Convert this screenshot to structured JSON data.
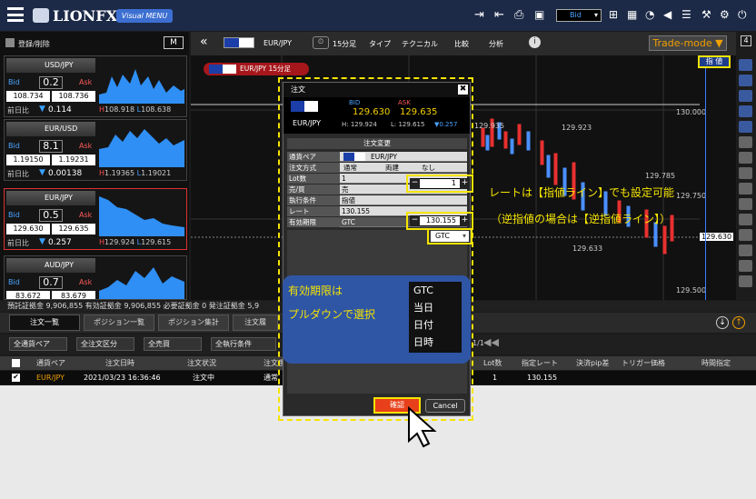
{
  "app": {
    "logo_text": "LIONFX",
    "visual_menu": "Visual MENU",
    "price_type_select": "Bid",
    "accent": "#f5e400"
  },
  "pairs": [
    {
      "name": "USD/JPY",
      "bid_label": "Bid",
      "ask_label": "Ask",
      "spread": "0.2",
      "bid": "108.734",
      "ask": "108.736",
      "prev_label": "前日比",
      "change": "0.114",
      "high": "108.918",
      "low": "108.638"
    },
    {
      "name": "EUR/USD",
      "bid_label": "Bid",
      "ask_label": "Ask",
      "spread": "8.1",
      "bid": "1.19150",
      "ask": "1.19231",
      "prev_label": "前日比",
      "change": "0.00138",
      "high": "1.19365",
      "low": "1.19021"
    },
    {
      "name": "EUR/JPY",
      "bid_label": "Bid",
      "ask_label": "Ask",
      "spread": "0.5",
      "bid": "129.630",
      "ask": "129.635",
      "prev_label": "前日比",
      "change": "0.257",
      "high": "129.924",
      "low": "129.615"
    },
    {
      "name": "AUD/JPY",
      "bid_label": "Bid",
      "ask_label": "Ask",
      "spread": "0.7",
      "bid": "83.672",
      "ask": "83.679",
      "prev_label": "",
      "change": "",
      "high": "",
      "low": ""
    }
  ],
  "left_header": {
    "title": "登録/削除",
    "m_button": "M"
  },
  "chart": {
    "pair": "EUR/JPY",
    "interval": "15分足",
    "type_label": "タイプ",
    "tech_label": "テクニカル",
    "compare_label": "比較",
    "analysis_label": "分析",
    "trade_mode": "Trade-mode ▼",
    "tag": "EUR/JPY 15分足",
    "limit_badge": "指 値",
    "num_badge": "4",
    "price_labels": [
      "130.000",
      "129.935",
      "129.785",
      "129.750",
      "129.633",
      "129.630",
      "129.500",
      "129.923"
    ],
    "current_price": "129.630"
  },
  "status": {
    "line": "預託証拠金  9,906,855   有効証拠金  9,906,855   必要証拠金  0   発注証拠金  5,9"
  },
  "tabs": [
    "注文一覧",
    "ポジション一覧",
    "ポジション集計",
    "注文履"
  ],
  "filters": [
    "全通貨ペア",
    "全注文区分",
    "全売買",
    "全執行条件"
  ],
  "page_indicator": "1/1",
  "table": {
    "headers": [
      "通貨ペア",
      "注文日時",
      "注文状況",
      "注文手",
      "Lot数",
      "指定レート",
      "決済pip差",
      "トリガー価格",
      "時間指定"
    ],
    "row": {
      "pair": "EUR/JPY",
      "datetime": "2021/03/23 16:36:46",
      "status": "注文中",
      "method": "通常",
      "lots": "1",
      "rate": "130.155"
    }
  },
  "dialog": {
    "title": "注文",
    "pair": "EUR/JPY",
    "bid_label": "BID",
    "ask_label": "ASK",
    "bid": "129.630",
    "ask": "129.635",
    "high": "H: 129.924",
    "low": "L: 129.615",
    "change": "▼0.257",
    "section": "注文変更",
    "rows": {
      "pair_label": "通貨ペア",
      "pair_value": "EUR/JPY",
      "method_label": "注文方式",
      "method_normal": "通常",
      "method_both": "両建",
      "method_none": "なし",
      "lot_label": "Lot数",
      "lot_value": "1",
      "side_label": "売/買",
      "side_value": "売",
      "cond_label": "執行条件",
      "cond_value": "指値",
      "rate_label": "レート",
      "rate_value": "130.155",
      "expiry_label": "有効期限",
      "expiry_value": "GTC"
    },
    "lot_stepper": "1",
    "rate_stepper": "130.155",
    "expiry_select": "GTC",
    "confirm": "確認",
    "cancel": "Cancel"
  },
  "callouts": {
    "rate_note_1": "レートは【指値ライン】でも設定可能",
    "rate_note_2": "（逆指値の場合は【逆指値ライン】）",
    "expiry_note_1": "有効期限は",
    "expiry_note_2": "プルダウンで選択"
  },
  "expiry_options": [
    "GTC",
    "当日",
    "日付",
    "日時"
  ]
}
